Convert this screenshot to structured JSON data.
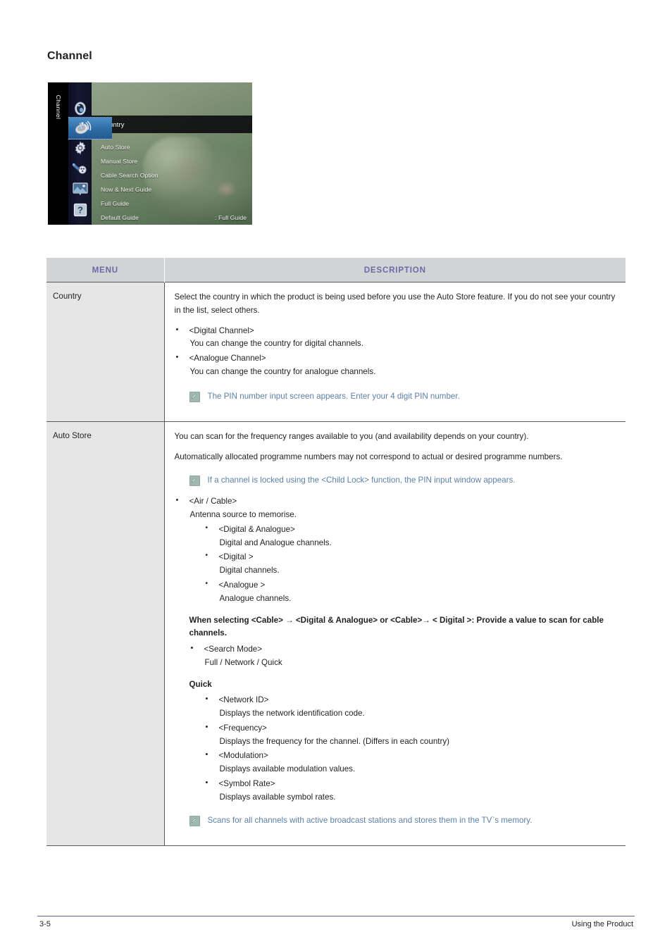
{
  "page": {
    "title": "Channel"
  },
  "osd": {
    "tab_label": "Channel",
    "icons": [
      {
        "name": "sound-icon",
        "selected": false
      },
      {
        "name": "satellite-dish-icon",
        "selected": true
      },
      {
        "name": "gear-icon",
        "selected": false
      },
      {
        "name": "plug-icon",
        "selected": false
      },
      {
        "name": "picture-icon",
        "selected": false
      },
      {
        "name": "help-icon",
        "selected": false
      }
    ],
    "rows": [
      {
        "label": "Country",
        "value": "",
        "highlight": true
      },
      {
        "label": "Auto Store",
        "value": "",
        "highlight": false
      },
      {
        "label": "Manual Store",
        "value": "",
        "highlight": false
      },
      {
        "label": "Cable Search Option",
        "value": "",
        "highlight": false
      },
      {
        "label": "Now & Next Guide",
        "value": "",
        "highlight": false
      },
      {
        "label": "Full Guide",
        "value": "",
        "highlight": false
      },
      {
        "label": "Default Guide",
        "value": ": Full Guide",
        "highlight": false
      }
    ]
  },
  "table": {
    "headers": {
      "menu": "MENU",
      "description": "DESCRIPTION"
    },
    "rows": {
      "country": {
        "menu": "Country",
        "intro": "Select the country in which the product is being used before you use the Auto Store feature. If you do not see your country in the list, select others.",
        "bullets": [
          {
            "title": "<Digital Channel>",
            "desc": "You can change the country for digital channels."
          },
          {
            "title": "<Analogue Channel>",
            "desc": "You can change the country for analogue channels."
          }
        ],
        "note": "The PIN number input screen appears. Enter your 4 digit PIN number."
      },
      "auto_store": {
        "menu": "Auto Store",
        "para1": "You can scan for the frequency ranges available to you (and availability depends on your country).",
        "para2": "Automatically allocated programme numbers may not correspond to actual or desired programme numbers.",
        "note1": "If a channel is locked using the <Child Lock> function, the PIN input window appears.",
        "air_cable": {
          "title": "<Air  / Cable>",
          "desc": "Antenna source to memorise.",
          "sub_bullets": [
            {
              "title": "<Digital & Analogue>",
              "desc": "Digital and Analogue channels."
            },
            {
              "title": "<Digital >",
              "desc": "Digital channels."
            },
            {
              "title": "<Analogue >",
              "desc": "Analogue channels."
            }
          ]
        },
        "cable_note_bold": "When selecting <Cable> → <Digital & Analogue> or <Cable>→ < Digital >: Provide a value to scan for cable channels.",
        "search_mode": {
          "title": "<Search Mode>",
          "desc": "Full / Network / Quick"
        },
        "quick_title": "Quick",
        "quick_bullets": [
          {
            "title": "<Network ID>",
            "desc": "Displays the network identification code."
          },
          {
            "title": "<Frequency>",
            "desc": "Displays the frequency for the channel. (Differs in each country)"
          },
          {
            "title": "<Modulation>",
            "desc": "Displays available modulation values."
          },
          {
            "title": "<Symbol Rate>",
            "desc": "Displays available symbol rates."
          }
        ],
        "note2": "Scans for all channels with active broadcast stations and stores them in the TV`s memory."
      }
    }
  },
  "footer": {
    "page_number": "3-5",
    "section": "Using the Product"
  },
  "colors": {
    "header_text": "#6a6aa8",
    "header_bg": "#d1d3d4",
    "menu_cell_bg": "#e6e6e6",
    "note_text": "#5c80a8",
    "note_icon_bg": "#9fb9b0",
    "footer_rule": "#5c5f9b",
    "body_text": "#231f20"
  }
}
